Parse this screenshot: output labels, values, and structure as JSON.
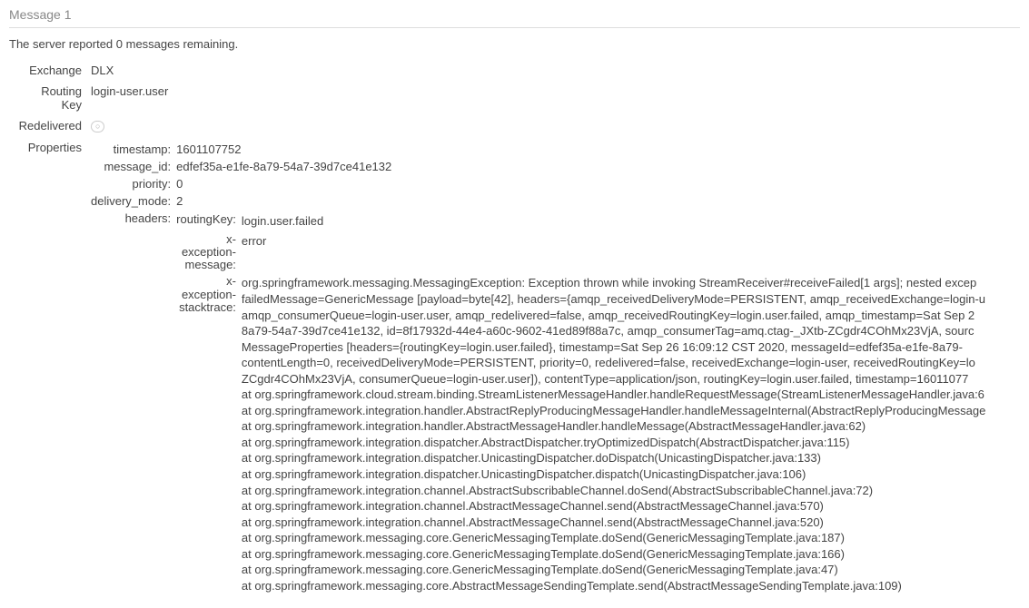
{
  "title": "Message 1",
  "remaining_prefix": "The server reported ",
  "remaining_count": "0",
  "remaining_suffix": " messages remaining.",
  "labels": {
    "exchange": "Exchange",
    "routing_key": "Routing\nKey",
    "redelivered": "Redelivered",
    "properties": "Properties"
  },
  "values": {
    "exchange": "DLX",
    "routing_key": "login-user.user",
    "redelivered": "○"
  },
  "props": {
    "labels": {
      "timestamp": "timestamp:",
      "message_id": "message_id:",
      "priority": "priority:",
      "delivery_mode": "delivery_mode:",
      "headers": "headers:"
    },
    "values": {
      "timestamp": "1601107752",
      "message_id": "edfef35a-e1fe-8a79-54a7-39d7ce41e132",
      "priority": "0",
      "delivery_mode": "2"
    }
  },
  "headers": {
    "labels": {
      "routingKey": "routingKey:",
      "x_exception_message": "x-\nexception-\nmessage:",
      "x_exception_stacktrace": "x-\nexception-\nstacktrace:"
    },
    "values": {
      "routingKey": "login.user.failed",
      "x_exception_message": "error",
      "x_exception_stacktrace": "org.springframework.messaging.MessagingException: Exception thrown while invoking StreamReceiver#receiveFailed[1 args]; nested excep\nfailedMessage=GenericMessage [payload=byte[42], headers={amqp_receivedDeliveryMode=PERSISTENT, amqp_receivedExchange=login-u\namqp_consumerQueue=login-user.user, amqp_redelivered=false, amqp_receivedRoutingKey=login.user.failed, amqp_timestamp=Sat Sep 2\n8a79-54a7-39d7ce41e132, id=8f17932d-44e4-a60c-9602-41ed89f88a7c, amqp_consumerTag=amq.ctag-_JXtb-ZCgdr4COhMx23VjA, sourc\nMessageProperties [headers={routingKey=login.user.failed}, timestamp=Sat Sep 26 16:09:12 CST 2020, messageId=edfef35a-e1fe-8a79-\ncontentLength=0, receivedDeliveryMode=PERSISTENT, priority=0, redelivered=false, receivedExchange=login-user, receivedRoutingKey=lo\nZCgdr4COhMx23VjA, consumerQueue=login-user.user]), contentType=application/json, routingKey=login.user.failed, timestamp=16011077\nat org.springframework.cloud.stream.binding.StreamListenerMessageHandler.handleRequestMessage(StreamListenerMessageHandler.java:6\nat org.springframework.integration.handler.AbstractReplyProducingMessageHandler.handleMessageInternal(AbstractReplyProducingMessage\nat org.springframework.integration.handler.AbstractMessageHandler.handleMessage(AbstractMessageHandler.java:62)\nat org.springframework.integration.dispatcher.AbstractDispatcher.tryOptimizedDispatch(AbstractDispatcher.java:115)\nat org.springframework.integration.dispatcher.UnicastingDispatcher.doDispatch(UnicastingDispatcher.java:133)\nat org.springframework.integration.dispatcher.UnicastingDispatcher.dispatch(UnicastingDispatcher.java:106)\nat org.springframework.integration.channel.AbstractSubscribableChannel.doSend(AbstractSubscribableChannel.java:72)\nat org.springframework.integration.channel.AbstractMessageChannel.send(AbstractMessageChannel.java:570)\nat org.springframework.integration.channel.AbstractMessageChannel.send(AbstractMessageChannel.java:520)\nat org.springframework.messaging.core.GenericMessagingTemplate.doSend(GenericMessagingTemplate.java:187)\nat org.springframework.messaging.core.GenericMessagingTemplate.doSend(GenericMessagingTemplate.java:166)\nat org.springframework.messaging.core.GenericMessagingTemplate.doSend(GenericMessagingTemplate.java:47)\nat org.springframework.messaging.core.AbstractMessageSendingTemplate.send(AbstractMessageSendingTemplate.java:109)"
    }
  }
}
